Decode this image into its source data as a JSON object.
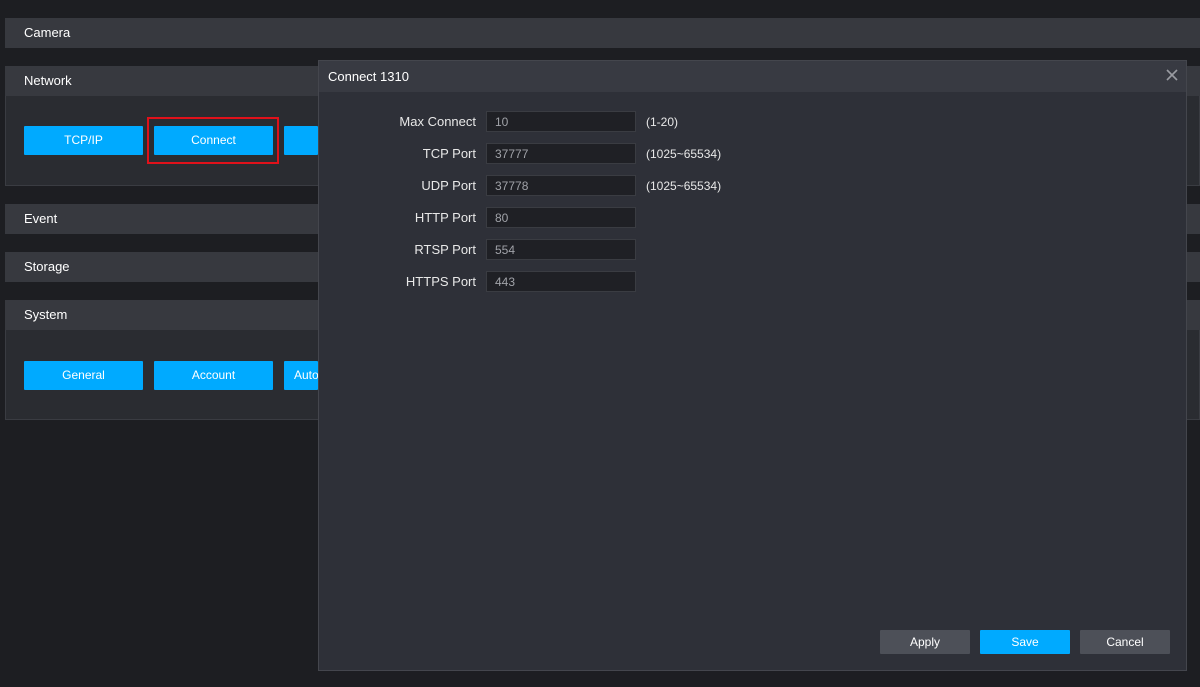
{
  "sections": {
    "camera": {
      "title": "Camera"
    },
    "network": {
      "title": "Network",
      "buttons": [
        "TCP/IP",
        "Connect",
        ""
      ]
    },
    "event": {
      "title": "Event"
    },
    "storage": {
      "title": "Storage"
    },
    "system": {
      "title": "System",
      "buttons": [
        "General",
        "Account",
        "Auto"
      ]
    }
  },
  "dialog": {
    "title": "Connect 1310",
    "fields": [
      {
        "label": "Max Connect",
        "value": "10",
        "hint": "(1-20)"
      },
      {
        "label": "TCP Port",
        "value": "37777",
        "hint": "(1025~65534)"
      },
      {
        "label": "UDP Port",
        "value": "37778",
        "hint": "(1025~65534)"
      },
      {
        "label": "HTTP Port",
        "value": "80",
        "hint": ""
      },
      {
        "label": "RTSP Port",
        "value": "554",
        "hint": ""
      },
      {
        "label": "HTTPS Port",
        "value": "443",
        "hint": ""
      }
    ],
    "buttons": {
      "apply": "Apply",
      "save": "Save",
      "cancel": "Cancel"
    }
  },
  "colors": {
    "accent": "#00aaff",
    "highlight": "#e0111a",
    "background": "#1d1e22",
    "dialog": "#2e3038"
  },
  "icons": {
    "close": "close-icon"
  }
}
